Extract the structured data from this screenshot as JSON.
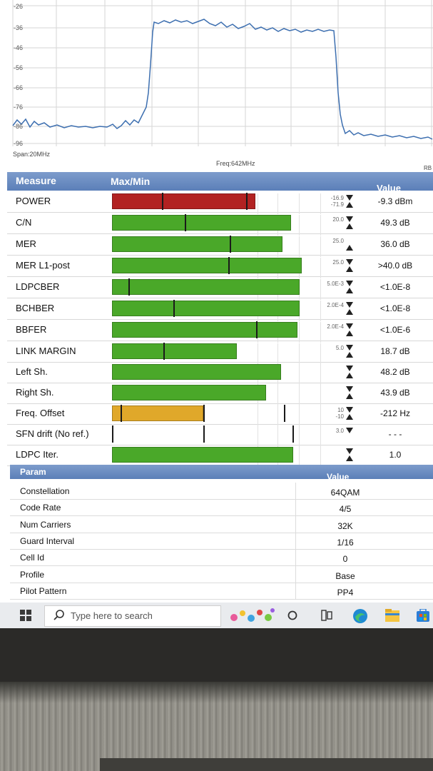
{
  "spectrum": {
    "y_ticks": [
      "-26",
      "-36",
      "-46",
      "-56",
      "-66",
      "-76",
      "-86",
      "-96"
    ],
    "span_label": "Span:20MHz",
    "freq_label": "Freq:642MHz",
    "rb_label": "RB",
    "trace_color": "#3d6fb0"
  },
  "measure_header": {
    "measure": "Measure",
    "maxmin": "Max/Min",
    "value": "Value"
  },
  "measures": [
    {
      "name": "POWER",
      "limit_hi": "-16.9",
      "limit_lo": "-71.9",
      "value": "-9.3 dBm",
      "bar_fraction": 0.69,
      "bar_color": "#b22222",
      "arrows": "both"
    },
    {
      "name": "C/N",
      "limit_hi": "",
      "limit_lo": "20.0",
      "value": "49.3 dB",
      "bar_fraction": 0.86,
      "bar_color": "#4aa829",
      "arrows": "both"
    },
    {
      "name": "MER",
      "limit_hi": "",
      "limit_lo": "25.0",
      "value": "36.0 dB",
      "bar_fraction": 0.82,
      "bar_color": "#4aa829",
      "arrows": "up"
    },
    {
      "name": "MER L1-post",
      "limit_hi": "",
      "limit_lo": "25.0",
      "value": ">40.0 dB",
      "bar_fraction": 0.91,
      "bar_color": "#4aa829",
      "arrows": "both"
    },
    {
      "name": "LDPCBER",
      "limit_hi": "",
      "limit_lo": "5.0E-3",
      "value": "<1.0E-8",
      "bar_fraction": 0.9,
      "bar_color": "#4aa829",
      "arrows": "both"
    },
    {
      "name": "BCHBER",
      "limit_hi": "",
      "limit_lo": "2.0E-4",
      "value": "<1.0E-8",
      "bar_fraction": 0.9,
      "bar_color": "#4aa829",
      "arrows": "both"
    },
    {
      "name": "BBFER",
      "limit_hi": "",
      "limit_lo": "2.0E-4",
      "value": "<1.0E-6",
      "bar_fraction": 0.89,
      "bar_color": "#4aa829",
      "arrows": "both"
    },
    {
      "name": "LINK MARGIN",
      "limit_hi": "",
      "limit_lo": "5.0",
      "value": "18.7 dB",
      "bar_fraction": 0.6,
      "bar_color": "#4aa829",
      "arrows": "both"
    },
    {
      "name": "Left Sh.",
      "limit_hi": "",
      "limit_lo": "",
      "value": "48.2 dB",
      "bar_fraction": 0.81,
      "bar_color": "#4aa829",
      "arrows": "both"
    },
    {
      "name": "Right Sh.",
      "limit_hi": "",
      "limit_lo": "",
      "value": "43.9 dB",
      "bar_fraction": 0.74,
      "bar_color": "#4aa829",
      "arrows": "both"
    },
    {
      "name": "Freq. Offset",
      "limit_hi": "10",
      "limit_lo": "-10",
      "value": "-212 Hz",
      "bar_fraction": 0.44,
      "bar_color": "#e0a82a",
      "arrows": "both"
    },
    {
      "name": "SFN drift (No ref.)",
      "limit_hi": "",
      "limit_lo": "3.0",
      "value": "- - -",
      "bar_fraction": 0,
      "bar_color": "#4aa829",
      "arrows": "down"
    },
    {
      "name": "LDPC Iter.",
      "limit_hi": "",
      "limit_lo": "",
      "value": "1.0",
      "bar_fraction": 0.87,
      "bar_color": "#4aa829",
      "arrows": "both"
    }
  ],
  "param_header": {
    "param": "Param",
    "value": "Value"
  },
  "params": [
    {
      "name": "Constellation",
      "value": "64QAM"
    },
    {
      "name": "Code Rate",
      "value": "4/5"
    },
    {
      "name": "Num Carriers",
      "value": "32K"
    },
    {
      "name": "Guard Interval",
      "value": "1/16"
    },
    {
      "name": "Cell Id",
      "value": "0"
    },
    {
      "name": "Profile",
      "value": "Base"
    },
    {
      "name": "Pilot Pattern",
      "value": "PP4"
    }
  ],
  "taskbar": {
    "search_placeholder": "Type here to search",
    "icons": [
      "windows-start-icon",
      "search-icon",
      "news-widget-icon",
      "task-view-icon",
      "widgets-icon",
      "edge-icon",
      "file-explorer-icon",
      "store-icon"
    ]
  }
}
